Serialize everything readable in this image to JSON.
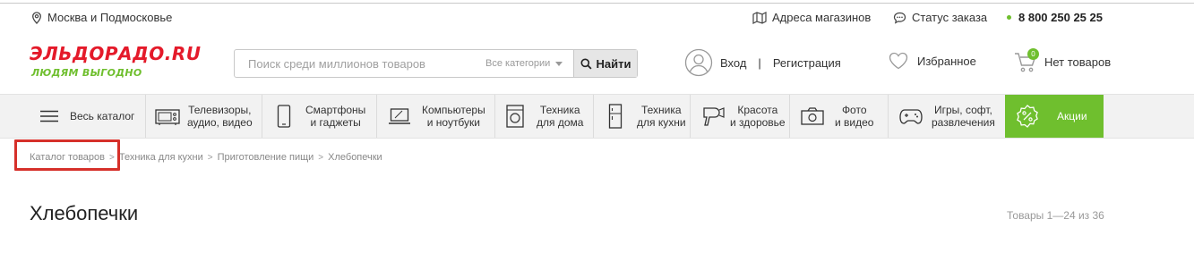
{
  "topbar": {
    "location": "Москва и Подмосковье",
    "stores": "Адреса магазинов",
    "order_status": "Статус заказа",
    "phone": "8 800 250 25 25"
  },
  "logo": {
    "name": "ЭЛЬДОРАДО.RU",
    "slogan": "ЛЮДЯМ ВЫГОДНО"
  },
  "search": {
    "placeholder": "Поиск среди миллионов товаров",
    "category": "Все категории",
    "button": "Найти"
  },
  "account": {
    "login": "Вход",
    "register": "Регистрация"
  },
  "favorites": {
    "label": "Избранное"
  },
  "cart": {
    "count": "0",
    "label": "Нет товаров"
  },
  "nav": {
    "catalog": "Весь каталог",
    "items": [
      {
        "line1": "Телевизоры,",
        "line2": "аудио, видео",
        "icon": "tv-icon"
      },
      {
        "line1": "Смартфоны",
        "line2": "и гаджеты",
        "icon": "smartphone-icon"
      },
      {
        "line1": "Компьютеры",
        "line2": "и ноутбуки",
        "icon": "laptop-icon"
      },
      {
        "line1": "Техника",
        "line2": "для дома",
        "icon": "washer-icon"
      },
      {
        "line1": "Техника",
        "line2": "для кухни",
        "icon": "fridge-icon"
      },
      {
        "line1": "Красота",
        "line2": "и здоровье",
        "icon": "hairdryer-icon"
      },
      {
        "line1": "Фото",
        "line2": "и видео",
        "icon": "camera-icon"
      },
      {
        "line1": "Игры, софт,",
        "line2": "развлечения",
        "icon": "gamepad-icon"
      }
    ],
    "promo": "Акции"
  },
  "breadcrumbs": [
    "Каталог товаров",
    "Техника для кухни",
    "Приготовление пищи",
    "Хлебопечки"
  ],
  "page": {
    "title": "Хлебопечки",
    "count": "Товары 1—24 из 36"
  },
  "colors": {
    "brand_red": "#e41a2a",
    "brand_green": "#6fbf2e",
    "highlight": "#d6302a"
  }
}
